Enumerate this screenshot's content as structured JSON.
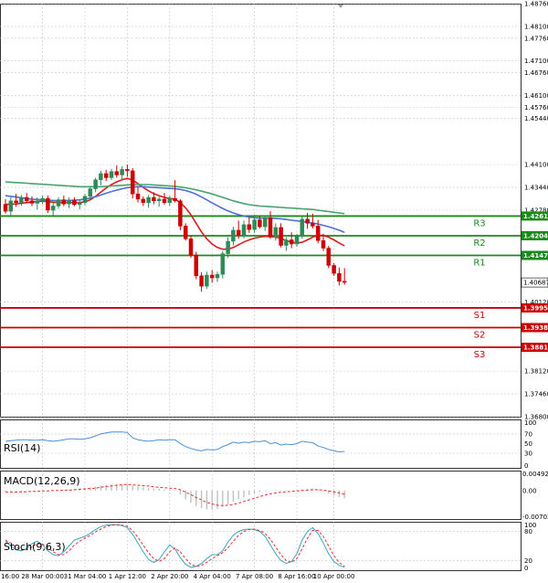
{
  "colors": {
    "bull": "#2e8b57",
    "bear": "#cc0000",
    "ma_red": "#dd1a1a",
    "ma_blue": "#4d6fd6",
    "ma_green": "#48a36a",
    "resistance": "#1a8a1a",
    "support": "#cc0000",
    "rsi": "#4c8ed9",
    "macd_hist": "#c0c0c0",
    "signal": "#e83030",
    "stoch_main": "#3aa3c2",
    "grid": "#bfc6cc"
  },
  "chart_data": [
    {
      "type": "candlestick",
      "name": "price",
      "ylim": [
        1.368,
        1.4876
      ],
      "y_ticks": [
        "1.48760",
        "1.48100",
        "1.47760",
        "1.47100",
        "1.46760",
        "1.46100",
        "1.45760",
        "1.45440",
        "1.44100",
        "1.43440",
        "1.42780",
        "1.42610",
        "1.42040",
        "1.41470",
        "1.40687",
        "1.40120",
        "1.39950",
        "1.39380",
        "1.38810",
        "1.38120",
        "1.37460",
        "1.36800"
      ],
      "x_labels": [
        "16:00",
        "28 Mar 00:00",
        "31 Mar 04:00",
        "1 Apr 12:00",
        "2 Apr 20:00",
        "4 Apr 04:00",
        "7 Apr 08:00",
        "8 Apr 16:00",
        "10 Apr 00:00"
      ],
      "last_price": "1.40687",
      "levels": [
        {
          "name": "R3",
          "value": 1.4261,
          "label": "1.42610",
          "kind": "resistance"
        },
        {
          "name": "R2",
          "value": 1.4204,
          "label": "1.42040",
          "kind": "resistance"
        },
        {
          "name": "R1",
          "value": 1.4147,
          "label": "1.41470",
          "kind": "resistance"
        },
        {
          "name": "S1",
          "value": 1.3995,
          "label": "1.39950",
          "kind": "support"
        },
        {
          "name": "S2",
          "value": 1.3938,
          "label": "1.39380",
          "kind": "support"
        },
        {
          "name": "S3",
          "value": 1.3881,
          "label": "1.38810",
          "kind": "support"
        }
      ],
      "candles": [
        [
          1.4295,
          1.431,
          1.4268,
          1.4275
        ],
        [
          1.4275,
          1.4315,
          1.4262,
          1.4305
        ],
        [
          1.4305,
          1.4325,
          1.4288,
          1.43
        ],
        [
          1.43,
          1.4322,
          1.429,
          1.4315
        ],
        [
          1.4315,
          1.4328,
          1.4298,
          1.4305
        ],
        [
          1.4305,
          1.4318,
          1.429,
          1.4298
        ],
        [
          1.4298,
          1.4315,
          1.428,
          1.4305
        ],
        [
          1.4305,
          1.432,
          1.4295,
          1.4312
        ],
        [
          1.4312,
          1.432,
          1.427,
          1.4278
        ],
        [
          1.4278,
          1.43,
          1.4262,
          1.429
        ],
        [
          1.429,
          1.4315,
          1.4282,
          1.4308
        ],
        [
          1.4308,
          1.432,
          1.429,
          1.4296
        ],
        [
          1.4296,
          1.4315,
          1.4284,
          1.4306
        ],
        [
          1.4306,
          1.4315,
          1.429,
          1.4294
        ],
        [
          1.4294,
          1.431,
          1.428,
          1.43
        ],
        [
          1.43,
          1.4325,
          1.4292,
          1.4318
        ],
        [
          1.4318,
          1.4345,
          1.431,
          1.434
        ],
        [
          1.434,
          1.4372,
          1.433,
          1.4366
        ],
        [
          1.4366,
          1.4392,
          1.435,
          1.4384
        ],
        [
          1.4384,
          1.4395,
          1.4362,
          1.4372
        ],
        [
          1.4372,
          1.4398,
          1.4365,
          1.439
        ],
        [
          1.439,
          1.4408,
          1.4372,
          1.438
        ],
        [
          1.438,
          1.4405,
          1.4366,
          1.4396
        ],
        [
          1.4396,
          1.441,
          1.4375,
          1.4392
        ],
        [
          1.4392,
          1.44,
          1.4312,
          1.4325
        ],
        [
          1.4325,
          1.4345,
          1.43,
          1.431
        ],
        [
          1.431,
          1.4318,
          1.429,
          1.43
        ],
        [
          1.43,
          1.4322,
          1.4285,
          1.4315
        ],
        [
          1.4315,
          1.433,
          1.4295,
          1.4305
        ],
        [
          1.4305,
          1.432,
          1.4288,
          1.431
        ],
        [
          1.431,
          1.4328,
          1.4294,
          1.43
        ],
        [
          1.43,
          1.432,
          1.429,
          1.4312
        ],
        [
          1.4312,
          1.4365,
          1.43,
          1.4305
        ],
        [
          1.4305,
          1.431,
          1.422,
          1.4232
        ],
        [
          1.4232,
          1.424,
          1.419,
          1.4195
        ],
        [
          1.4195,
          1.4205,
          1.414,
          1.4148
        ],
        [
          1.4148,
          1.4158,
          1.4078,
          1.4088
        ],
        [
          1.4088,
          1.4098,
          1.4042,
          1.4058
        ],
        [
          1.4058,
          1.41,
          1.405,
          1.409
        ],
        [
          1.409,
          1.4105,
          1.4068,
          1.4082
        ],
        [
          1.4082,
          1.41,
          1.407,
          1.4092
        ],
        [
          1.4092,
          1.416,
          1.408,
          1.4152
        ],
        [
          1.4152,
          1.42,
          1.414,
          1.4188
        ],
        [
          1.4188,
          1.423,
          1.4176,
          1.422
        ],
        [
          1.422,
          1.4248,
          1.4195,
          1.4206
        ],
        [
          1.4206,
          1.4248,
          1.4196,
          1.4236
        ],
        [
          1.4236,
          1.4258,
          1.4212,
          1.4222
        ],
        [
          1.4222,
          1.4265,
          1.4212,
          1.425
        ],
        [
          1.425,
          1.4262,
          1.4225,
          1.423
        ],
        [
          1.423,
          1.4262,
          1.4218,
          1.4256
        ],
        [
          1.4256,
          1.4275,
          1.4195,
          1.42
        ],
        [
          1.42,
          1.424,
          1.419,
          1.4228
        ],
        [
          1.4228,
          1.424,
          1.417,
          1.4176
        ],
        [
          1.4176,
          1.42,
          1.416,
          1.4192
        ],
        [
          1.4192,
          1.4214,
          1.4168,
          1.418
        ],
        [
          1.418,
          1.421,
          1.4172,
          1.4202
        ],
        [
          1.4202,
          1.4262,
          1.4196,
          1.4252
        ],
        [
          1.4252,
          1.427,
          1.4224,
          1.424
        ],
        [
          1.424,
          1.4268,
          1.4225,
          1.4232
        ],
        [
          1.4232,
          1.425,
          1.4182,
          1.419
        ],
        [
          1.419,
          1.421,
          1.416,
          1.4168
        ],
        [
          1.4168,
          1.4175,
          1.411,
          1.4118
        ],
        [
          1.4118,
          1.4125,
          1.4088,
          1.4095
        ],
        [
          1.4095,
          1.4112,
          1.406,
          1.4072
        ],
        [
          1.4072,
          1.411,
          1.4062,
          1.4069
        ]
      ],
      "series": [
        {
          "name": "MA red",
          "color_key": "ma_red",
          "values": [
            1.4295,
            1.4295,
            1.4296,
            1.4298,
            1.43,
            1.4302,
            1.4303,
            1.4304,
            1.4303,
            1.4301,
            1.43,
            1.43,
            1.43,
            1.43,
            1.43,
            1.4302,
            1.4308,
            1.4318,
            1.433,
            1.4342,
            1.4352,
            1.436,
            1.4366,
            1.437,
            1.4365,
            1.4355,
            1.4344,
            1.4334,
            1.4326,
            1.432,
            1.4315,
            1.4312,
            1.431,
            1.43,
            1.4285,
            1.4265,
            1.424,
            1.4215,
            1.4195,
            1.418,
            1.417,
            1.4165,
            1.4165,
            1.417,
            1.4178,
            1.4186,
            1.4192,
            1.4197,
            1.42,
            1.4202,
            1.4202,
            1.42,
            1.4196,
            1.419,
            1.4185,
            1.4183,
            1.4185,
            1.4192,
            1.42,
            1.4205,
            1.4205,
            1.42,
            1.4192,
            1.4183,
            1.4175
          ]
        },
        {
          "name": "MA blue",
          "color_key": "ma_blue",
          "values": [
            1.432,
            1.4318,
            1.4316,
            1.4314,
            1.4312,
            1.431,
            1.4309,
            1.4308,
            1.4307,
            1.4306,
            1.4306,
            1.4306,
            1.4306,
            1.4307,
            1.4308,
            1.431,
            1.4313,
            1.4317,
            1.4322,
            1.4327,
            1.4332,
            1.4336,
            1.434,
            1.4343,
            1.4345,
            1.4346,
            1.4346,
            1.4345,
            1.4344,
            1.4343,
            1.4342,
            1.4341,
            1.434,
            1.4338,
            1.4335,
            1.433,
            1.4324,
            1.4316,
            1.4308,
            1.4299,
            1.4291,
            1.4283,
            1.4276,
            1.427,
            1.4265,
            1.4261,
            1.4258,
            1.4256,
            1.4255,
            1.4255,
            1.4255,
            1.4254,
            1.4253,
            1.4251,
            1.4249,
            1.4247,
            1.4245,
            1.4243,
            1.4241,
            1.4238,
            1.4234,
            1.423,
            1.4225,
            1.422,
            1.4214
          ]
        },
        {
          "name": "MA green",
          "color_key": "ma_green",
          "values": [
            1.436,
            1.4359,
            1.4358,
            1.4357,
            1.4356,
            1.4355,
            1.4354,
            1.4353,
            1.4352,
            1.4351,
            1.435,
            1.4349,
            1.4348,
            1.4347,
            1.4346,
            1.4346,
            1.4346,
            1.4346,
            1.4346,
            1.4347,
            1.4348,
            1.4349,
            1.435,
            1.4351,
            1.4352,
            1.4352,
            1.4352,
            1.4352,
            1.4351,
            1.435,
            1.4349,
            1.4348,
            1.4347,
            1.4345,
            1.4343,
            1.434,
            1.4337,
            1.4333,
            1.4329,
            1.4325,
            1.432,
            1.4315,
            1.431,
            1.4305,
            1.4301,
            1.4297,
            1.4294,
            1.4292,
            1.429,
            1.4289,
            1.4288,
            1.4287,
            1.4286,
            1.4285,
            1.4284,
            1.4283,
            1.4282,
            1.4281,
            1.428,
            1.4278,
            1.4276,
            1.4274,
            1.4272,
            1.427,
            1.4268
          ]
        }
      ]
    },
    {
      "type": "line",
      "name": "RSI(14)",
      "ylim": [
        0,
        100
      ],
      "y_ticks": [
        "100",
        "70",
        "50",
        "30",
        "0"
      ],
      "values": [
        55,
        56,
        57,
        58,
        58,
        57,
        57,
        58,
        56,
        55,
        56,
        58,
        60,
        60,
        59,
        60,
        62,
        66,
        70,
        72,
        74,
        74,
        74,
        73,
        62,
        58,
        56,
        55,
        56,
        58,
        57,
        58,
        58,
        50,
        44,
        40,
        37,
        35,
        38,
        37,
        38,
        44,
        48,
        53,
        51,
        53,
        52,
        55,
        54,
        56,
        50,
        52,
        47,
        49,
        48,
        50,
        55,
        53,
        52,
        45,
        42,
        38,
        35,
        33,
        34
      ]
    },
    {
      "type": "bar",
      "name": "MACD(12,26,9)",
      "ylim": [
        -0.007,
        0.0049
      ],
      "y_ticks": [
        "0.004927",
        "0.00",
        "-0.00702"
      ],
      "series": [
        {
          "name": "histogram",
          "values": [
            -0.0003,
            -0.0003,
            -0.0002,
            -0.0002,
            -0.0001,
            -0.0001,
            0.0,
            0.0,
            0.0,
            0.0001,
            0.0001,
            0.0002,
            0.0003,
            0.0004,
            0.0005,
            0.0006,
            0.0008,
            0.001,
            0.0012,
            0.0014,
            0.0015,
            0.0016,
            0.0016,
            0.0016,
            0.0012,
            0.001,
            0.0008,
            0.0006,
            0.0005,
            0.0004,
            0.0003,
            0.0002,
            0.0001,
            -0.001,
            -0.0022,
            -0.003,
            -0.0038,
            -0.0043,
            -0.0046,
            -0.0047,
            -0.0045,
            -0.004,
            -0.0034,
            -0.0027,
            -0.0021,
            -0.0016,
            -0.0011,
            -0.0007,
            -0.0004,
            -0.0001,
            0.0,
            0.0001,
            0.0001,
            0.0001,
            0.0,
            0.0001,
            0.0003,
            0.0004,
            0.0004,
            0.0002,
            -0.0002,
            -0.0007,
            -0.0012,
            -0.0016,
            -0.0019
          ]
        },
        {
          "name": "signal",
          "values": [
            -0.0004,
            -0.0004,
            -0.0004,
            -0.0003,
            -0.0003,
            -0.0002,
            -0.0002,
            -0.0001,
            -0.0001,
            0.0,
            0.0,
            0.0001,
            0.0001,
            0.0002,
            0.0003,
            0.0004,
            0.0005,
            0.0006,
            0.0008,
            0.001,
            0.0011,
            0.0013,
            0.0014,
            0.0015,
            0.0014,
            0.0013,
            0.0012,
            0.0011,
            0.0009,
            0.0008,
            0.0007,
            0.0006,
            0.0005,
            0.0002,
            -0.0004,
            -0.001,
            -0.0017,
            -0.0023,
            -0.0029,
            -0.0033,
            -0.0036,
            -0.0037,
            -0.0036,
            -0.0034,
            -0.0031,
            -0.0027,
            -0.0023,
            -0.0019,
            -0.0015,
            -0.0011,
            -0.0008,
            -0.0006,
            -0.0004,
            -0.0003,
            -0.0002,
            -0.0001,
            0.0,
            0.0001,
            0.0002,
            0.0002,
            0.0001,
            -0.0001,
            -0.0003,
            -0.0006,
            -0.0009
          ]
        }
      ]
    },
    {
      "type": "line",
      "name": "Stoch(9,6,3)",
      "ylim": [
        0,
        100
      ],
      "y_ticks": [
        "100",
        "80",
        "20",
        "0"
      ],
      "series": [
        {
          "name": "main",
          "values": [
            60,
            50,
            42,
            40,
            45,
            55,
            60,
            52,
            40,
            32,
            30,
            38,
            50,
            62,
            66,
            70,
            76,
            84,
            90,
            93,
            94,
            94,
            92,
            88,
            74,
            56,
            38,
            22,
            16,
            22,
            38,
            52,
            44,
            26,
            12,
            6,
            8,
            14,
            24,
            32,
            32,
            40,
            58,
            72,
            80,
            84,
            85,
            84,
            80,
            70,
            52,
            34,
            20,
            14,
            18,
            34,
            62,
            80,
            88,
            76,
            56,
            34,
            18,
            10,
            6
          ]
        },
        {
          "name": "signal",
          "values": [
            62,
            56,
            48,
            42,
            42,
            48,
            55,
            54,
            47,
            38,
            32,
            32,
            40,
            52,
            60,
            66,
            72,
            79,
            85,
            90,
            93,
            94,
            93,
            91,
            82,
            68,
            52,
            36,
            24,
            18,
            24,
            38,
            46,
            38,
            24,
            12,
            8,
            10,
            16,
            24,
            30,
            36,
            46,
            60,
            72,
            80,
            84,
            85,
            82,
            76,
            64,
            48,
            32,
            20,
            16,
            24,
            44,
            66,
            82,
            82,
            70,
            50,
            30,
            16,
            8
          ]
        }
      ]
    }
  ]
}
